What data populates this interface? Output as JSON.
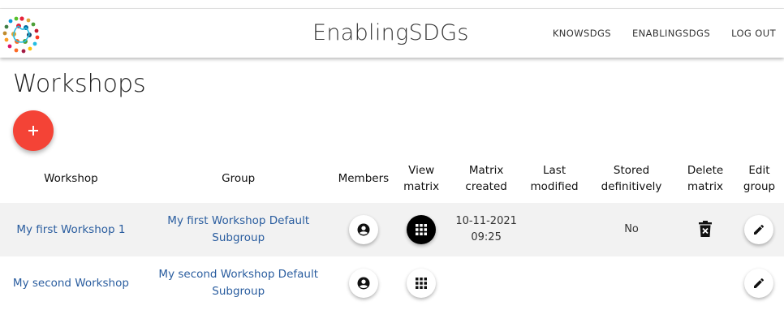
{
  "app": {
    "brand": "EnablingSDGs",
    "nav": [
      {
        "label": "KNOWSDGS"
      },
      {
        "label": "ENABLINGSDGS"
      },
      {
        "label": "LOG OUT"
      }
    ]
  },
  "page": {
    "title": "Workshops",
    "add_icon": "plus-icon"
  },
  "table": {
    "headers": {
      "workshop": "Workshop",
      "group": "Group",
      "members": "Members",
      "view_matrix_1": "View",
      "view_matrix_2": "matrix",
      "matrix_created_1": "Matrix",
      "matrix_created_2": "created",
      "last_modified_1": "Last",
      "last_modified_2": "modified",
      "stored_1": "Stored",
      "stored_2": "definitively",
      "delete_1": "Delete",
      "delete_2": "matrix",
      "edit_1": "Edit",
      "edit_2": "group"
    },
    "rows": [
      {
        "workshop": "My first Workshop 1",
        "group_line1": "My first Workshop Default",
        "group_line2": "Subgroup",
        "created_date": "10-11-2021",
        "created_time": "09:25",
        "last_modified": "",
        "stored": "No",
        "matrix_button_style": "filled-black",
        "has_delete": true
      },
      {
        "workshop": "My second Workshop",
        "group_line1": "My second Workshop Default",
        "group_line2": "Subgroup",
        "created_date": "",
        "created_time": "",
        "last_modified": "",
        "stored": "",
        "matrix_button_style": "outlined-white",
        "has_delete": false
      }
    ]
  },
  "colors": {
    "accent_red": "#f44336",
    "link_blue": "#2a5d9f",
    "row_highlight": "#f2f2f2"
  },
  "icons": [
    "sdg-logo",
    "plus-icon",
    "account-circle-icon",
    "grid-icon",
    "delete-icon",
    "pencil-icon"
  ]
}
